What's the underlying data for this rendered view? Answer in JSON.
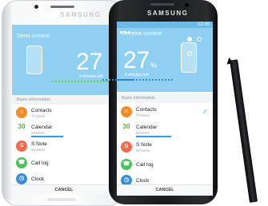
{
  "white_phone": {
    "brand": "SAMSUNG",
    "title": "Send content",
    "percent": "27",
    "remaining": "4 minutes left",
    "section_header": "Basic information",
    "items": [
      {
        "name": "Contacts",
        "count": "70 items",
        "icon_label": "person-icon",
        "color": "#f28c28"
      },
      {
        "name": "Calendar",
        "count": "50 items",
        "icon_label": "calendar-icon",
        "color": "#5aa83a",
        "day": "30"
      },
      {
        "name": "S Note",
        "count": "50 items",
        "icon_label": "s-note-icon",
        "color": "#f36b4a",
        "glyph": "S"
      },
      {
        "name": "Call log",
        "count": "",
        "icon_label": "phone-icon",
        "color": "#4cc35c"
      },
      {
        "name": "Clock",
        "count": "",
        "icon_label": "clock-icon",
        "color": "#3b8ed8"
      }
    ],
    "cancel": "CANCEL"
  },
  "black_phone": {
    "brand": "SAMSUNG",
    "status_time": "12:45",
    "title": "Receive content",
    "percent": "27",
    "percent_sign": "%",
    "remaining": "4 minutes left",
    "section_header": "Basic information",
    "items": [
      {
        "name": "Contacts",
        "count": "70 items",
        "icon_label": "person-icon",
        "color": "#f28c28",
        "checked": true
      },
      {
        "name": "Calendar",
        "count": "50 items",
        "icon_label": "calendar-icon",
        "color": "#5aa83a",
        "day": "30",
        "progress": 0.55
      },
      {
        "name": "S Note",
        "count": "50 items",
        "icon_label": "s-note-icon",
        "color": "#f36b4a",
        "glyph": "S"
      },
      {
        "name": "Call log",
        "count": "",
        "icon_label": "phone-icon",
        "color": "#4cc35c"
      },
      {
        "name": "Clock",
        "count": "",
        "icon_label": "clock-icon",
        "color": "#3b8ed8"
      }
    ],
    "cancel": "CANCEL"
  }
}
